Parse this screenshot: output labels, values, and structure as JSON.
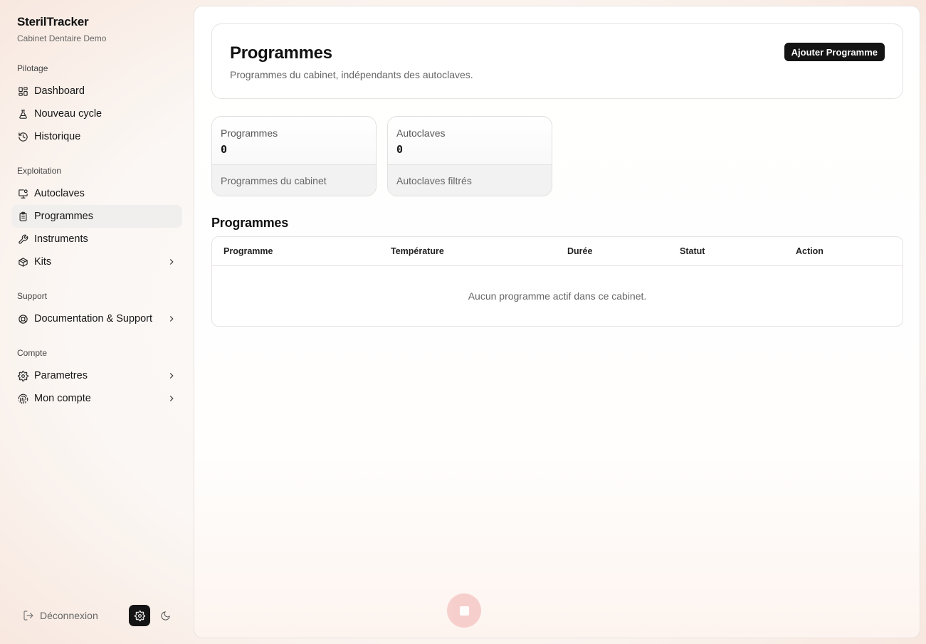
{
  "brand": {
    "title": "SterilTracker",
    "subtitle": "Cabinet Dentaire Demo"
  },
  "sidebar": {
    "sections": [
      {
        "label": "Pilotage"
      },
      {
        "label": "Exploitation"
      },
      {
        "label": "Support"
      },
      {
        "label": "Compte"
      }
    ],
    "items": [
      {
        "label": "Dashboard",
        "icon": "dashboard-icon"
      },
      {
        "label": "Nouveau cycle",
        "icon": "flask-icon"
      },
      {
        "label": "Historique",
        "icon": "history-icon"
      },
      {
        "label": "Autoclaves",
        "icon": "monitor-icon"
      },
      {
        "label": "Programmes",
        "icon": "clipboard-icon",
        "active": true
      },
      {
        "label": "Instruments",
        "icon": "wrench-icon"
      },
      {
        "label": "Kits",
        "icon": "package-icon",
        "has_submenu": true
      },
      {
        "label": "Documentation & Support",
        "icon": "lifebuoy-icon",
        "has_submenu": true
      },
      {
        "label": "Parametres",
        "icon": "gear-icon",
        "has_submenu": true
      },
      {
        "label": "Mon compte",
        "icon": "fingerprint-icon",
        "has_submenu": true
      }
    ],
    "footer": {
      "logout_label": "Déconnexion"
    }
  },
  "header": {
    "title": "Programmes",
    "subtitle": "Programmes du cabinet, indépendants des autoclaves.",
    "add_button": "Ajouter Programme"
  },
  "stats": [
    {
      "label": "Programmes",
      "value": "0",
      "footer": "Programmes du cabinet"
    },
    {
      "label": "Autoclaves",
      "value": "0",
      "footer": "Autoclaves filtrés"
    }
  ],
  "table": {
    "title": "Programmes",
    "columns": [
      "Programme",
      "Température",
      "Durée",
      "Statut",
      "Action"
    ],
    "rows": [],
    "empty_message": "Aucun programme actif dans ce cabinet."
  },
  "colors": {
    "accent": "#141414",
    "active_item_bg": "#f0efee",
    "fab": "#f5c9c6"
  }
}
